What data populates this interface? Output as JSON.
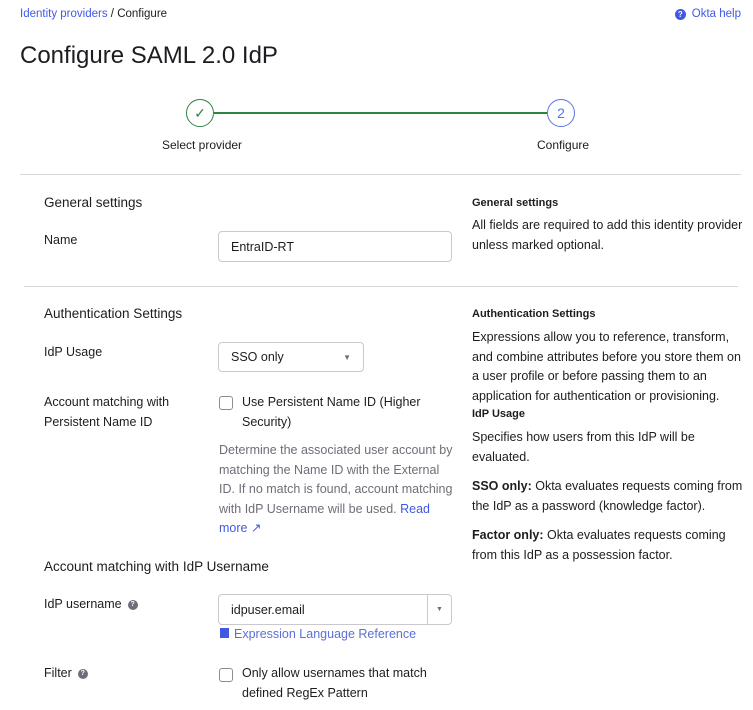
{
  "breadcrumb": {
    "link": "Identity providers",
    "sep": "/",
    "current": "Configure"
  },
  "help": {
    "label": "Okta help",
    "icon": "question-circle-icon"
  },
  "title": "Configure SAML 2.0 IdP",
  "stepper": {
    "step1": {
      "label": "Select provider",
      "icon": "check-icon"
    },
    "step2": {
      "number": "2",
      "label": "Configure"
    }
  },
  "general": {
    "heading": "General settings",
    "name_label": "Name",
    "name_value": "EntraID-RT",
    "side_heading": "General settings",
    "side_text": "All fields are required to add this identity provider unless marked optional."
  },
  "auth": {
    "heading": "Authentication Settings",
    "usage_label": "IdP Usage",
    "usage_value": "SSO only",
    "match_label": "Account matching with Persistent Name ID",
    "persist_checkbox": "Use Persistent Name ID (Higher Security)",
    "persist_help": "Determine the associated user account by matching the Name ID with the External ID. If no match is found, account matching with IdP Username will be used.",
    "read_more": "Read more",
    "side_heading": "Authentication Settings",
    "side_text": "Expressions allow you to reference, transform, and combine attributes before you store them on a user profile or before passing them to an application for authentication or provisioning.",
    "side_usage_heading": "IdP Usage",
    "side_usage_text": "Specifies how users from this IdP will be evaluated.",
    "side_sso_bold": "SSO only:",
    "side_sso_text": "Okta evaluates requests coming from the IdP as a password (knowledge factor).",
    "side_factor_bold": "Factor only:",
    "side_factor_text": "Okta evaluates requests coming from this IdP as a possession factor."
  },
  "username": {
    "heading": "Account matching with IdP Username",
    "label": "IdP username",
    "value": "idpuser.email",
    "expr_link": "Expression Language Reference",
    "filter_label": "Filter",
    "filter_checkbox": "Only allow usernames that match defined RegEx Pattern"
  }
}
